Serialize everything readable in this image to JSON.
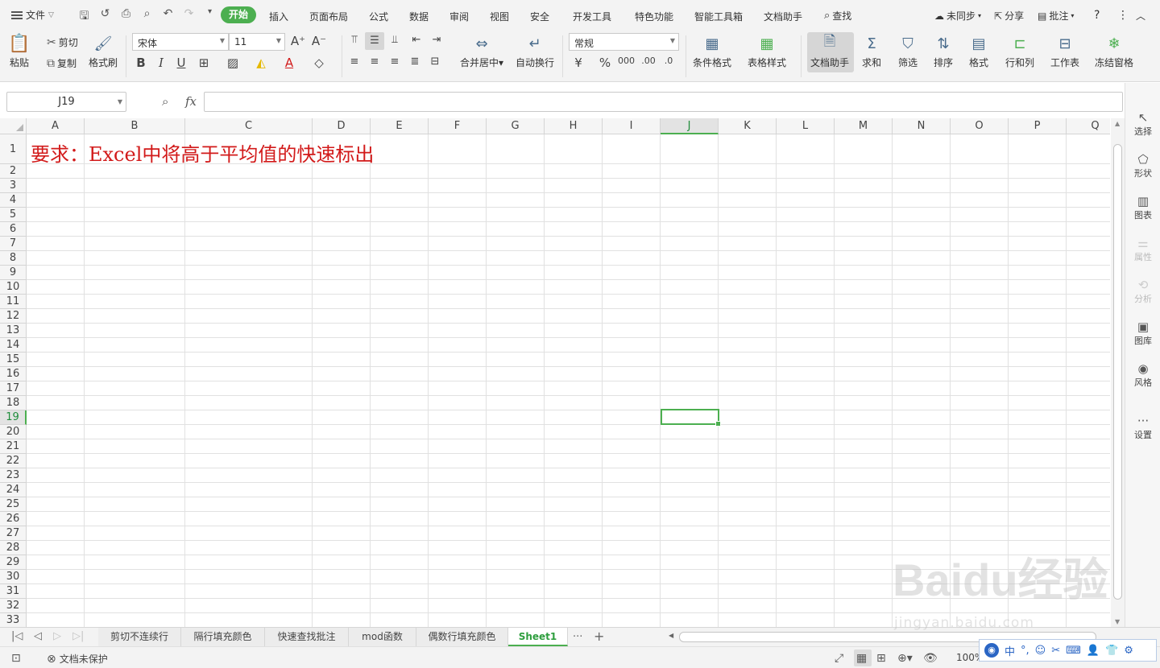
{
  "menubar": {
    "file_label": "文件",
    "tabs": [
      "开始",
      "插入",
      "页面布局",
      "公式",
      "数据",
      "审阅",
      "视图",
      "安全",
      "开发工具",
      "特色功能",
      "智能工具箱",
      "文档助手"
    ],
    "search_label": "查找",
    "sync_label": "未同步",
    "share_label": "分享",
    "comment_label": "批注",
    "help_label": "?"
  },
  "ribbon": {
    "paste": "粘贴",
    "cut": "剪切",
    "copy": "复制",
    "format_painter": "格式刷",
    "font_name": "宋体",
    "font_size": "11",
    "bold": "B",
    "italic": "I",
    "underline": "U",
    "merge_center": "合并居中",
    "wrap_text": "自动换行",
    "number_format": "常规",
    "conditional_format": "条件格式",
    "table_style": "表格样式",
    "doc_helper": "文档助手",
    "sum": "求和",
    "filter": "筛选",
    "sort": "排序",
    "format": "格式",
    "row_col": "行和列",
    "worksheet": "工作表",
    "freeze": "冻结窗格"
  },
  "formula_bar": {
    "name_box": "J19",
    "fx_label": "fx",
    "formula": ""
  },
  "grid": {
    "columns": [
      "A",
      "B",
      "C",
      "D",
      "E",
      "F",
      "G",
      "H",
      "I",
      "J",
      "K",
      "L",
      "M",
      "N",
      "O",
      "P",
      "Q"
    ],
    "rows": [
      "1",
      "2",
      "3",
      "4",
      "5",
      "6",
      "7",
      "8",
      "9",
      "10",
      "11",
      "12",
      "13",
      "14",
      "15",
      "16",
      "17",
      "18",
      "19",
      "20",
      "21",
      "22",
      "23",
      "24",
      "25",
      "26",
      "27",
      "28",
      "29",
      "30",
      "31",
      "32",
      "33"
    ],
    "selected_column": "J",
    "selected_row": "19",
    "a1_text": "要求：Excel中将高于平均值的快速标出",
    "a1_color": "#d21a1a"
  },
  "side_panel": {
    "items": [
      "选择",
      "形状",
      "图表",
      "属性",
      "分析",
      "图库",
      "风格",
      "设置"
    ]
  },
  "sheets": {
    "tabs": [
      "剪切不连续行",
      "隔行填充颜色",
      "快速查找批注",
      "mod函数",
      "偶数行填充颜色",
      "Sheet1"
    ],
    "active": "Sheet1",
    "more": "···",
    "add": "+"
  },
  "status": {
    "protect_label": "文档未保护",
    "zoom": "100%"
  },
  "ime": {
    "lang": "中"
  },
  "watermark": {
    "main": "Baidu经验",
    "sub": "jingyan.baidu.com"
  },
  "colors": {
    "accent": "#4caf50",
    "active_sheet_text": "#2e9e3e"
  }
}
